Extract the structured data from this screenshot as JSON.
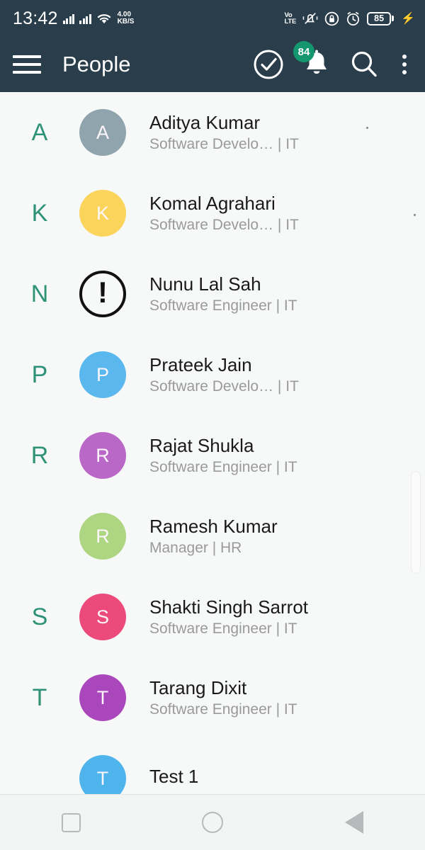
{
  "status_bar": {
    "time": "13:42",
    "net_speed_value": "4.00",
    "net_speed_unit": "KB/S",
    "volte_top": "Vo",
    "volte_bottom": "LTE",
    "battery_level": "85",
    "icons": [
      "signal-icon",
      "signal-icon",
      "wifi-icon",
      "volte-icon",
      "vibrate-icon",
      "screen-lock-rotation-icon",
      "alarm-icon",
      "battery-icon",
      "charging-bolt-icon"
    ],
    "bg_color": "#2a3d4a"
  },
  "app_bar": {
    "title": "People",
    "menu_icon": "hamburger-menu-icon",
    "check_icon": "check-circle-icon",
    "bell_icon": "bell-icon",
    "notification_count": "84",
    "search_icon": "search-icon",
    "overflow_icon": "more-vertical-icon",
    "bg_color": "#2a3d4a",
    "badge_color": "#14966f"
  },
  "list": {
    "section_letter_color": "#2e9277",
    "rows": [
      {
        "section": "A",
        "initial": "A",
        "avatar_color": "#90a4ae",
        "avatar_type": "initial",
        "name": "Aditya Kumar",
        "subtitle": "Software Develo…  | IT"
      },
      {
        "section": "K",
        "initial": "K",
        "avatar_color": "#fbd45c",
        "avatar_type": "initial",
        "name": "Komal Agrahari",
        "subtitle": "Software Develo…  | IT"
      },
      {
        "section": "N",
        "initial": "!",
        "avatar_color": "#111111",
        "avatar_type": "alert",
        "name": "Nunu Lal Sah",
        "subtitle": "Software Engineer | IT"
      },
      {
        "section": "P",
        "initial": "P",
        "avatar_color": "#5ab8ef",
        "avatar_type": "initial",
        "name": "Prateek Jain",
        "subtitle": "Software Develo…  | IT"
      },
      {
        "section": "R",
        "initial": "R",
        "avatar_color": "#ba68c8",
        "avatar_type": "initial",
        "name": "Rajat Shukla",
        "subtitle": "Software Engineer | IT"
      },
      {
        "section": "",
        "initial": "R",
        "avatar_color": "#aed581",
        "avatar_type": "initial",
        "name": "Ramesh Kumar",
        "subtitle": "Manager | HR"
      },
      {
        "section": "S",
        "initial": "S",
        "avatar_color": "#ec4a7b",
        "avatar_type": "initial",
        "name": "Shakti Singh Sarrot",
        "subtitle": "Software Engineer | IT"
      },
      {
        "section": "T",
        "initial": "T",
        "avatar_color": "#ab47bc",
        "avatar_type": "initial",
        "name": "Tarang Dixit",
        "subtitle": "Software Engineer | IT"
      },
      {
        "section": "",
        "initial": "T",
        "avatar_color": "#4fb3ec",
        "avatar_type": "initial",
        "name": "Test 1",
        "subtitle": ""
      }
    ]
  },
  "nav_bar": {
    "recents_icon": "square-recents-icon",
    "home_icon": "circle-home-icon",
    "back_icon": "triangle-back-icon"
  }
}
